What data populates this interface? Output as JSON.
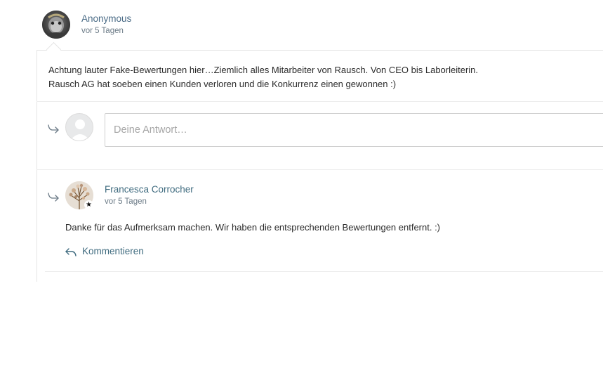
{
  "comment": {
    "author": "Anonymous",
    "time": "vor 5 Tagen",
    "avatar_icon": "user-avatar-photo",
    "body_line1": "Achtung lauter Fake-Bewertungen hier…Ziemlich alles Mitarbeiter von Rausch. Von CEO bis Laborleiterin.",
    "body_line2": "Rausch AG hat soeben einen Kunden verloren und die Konkurrenz einen gewonnen :)"
  },
  "reply_box": {
    "placeholder": "Deine Antwort…",
    "avatar_icon": "default-user-avatar",
    "arrow_icon": "reply-arrow-icon"
  },
  "reply": {
    "author": "Francesca Corrocher",
    "time": "vor 5 Tagen",
    "avatar_icon": "user-avatar-photo",
    "badge_icon": "star-badge-icon",
    "body": "Danke für das Aufmerksam machen. Wir haben die entsprechenden Bewertungen entfernt. :)",
    "action_label": "Kommentieren",
    "action_icon": "reply-back-arrow-icon"
  },
  "colors": {
    "link": "#3f6b7f",
    "author": "#4a6b86",
    "muted": "#6b7a86",
    "border": "#e4e4e4"
  }
}
